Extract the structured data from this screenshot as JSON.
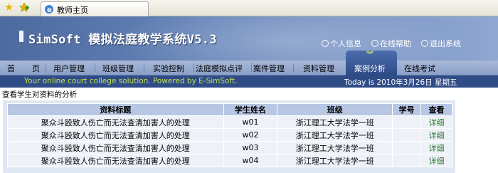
{
  "browser": {
    "tab_title": "教师主页"
  },
  "header": {
    "system_title": "SimSoft 模拟法庭教学系统V5.3",
    "links": [
      "个人信息",
      "在线帮助",
      "退出系统"
    ]
  },
  "nav": {
    "items": [
      "首",
      "页",
      "用户管理",
      "班级管理",
      "实验控制",
      "法庭模拟点评",
      "案件管理",
      "资料管理",
      "案例分析",
      "在线考试"
    ],
    "active": "案例分析"
  },
  "slogan": {
    "text": "Your online court college solution. Powered by E-SimSoft.",
    "today": "Today is  2010年3月26日  星期五"
  },
  "page_title": "查看学生对资料的分析",
  "table": {
    "columns": [
      "资料标题",
      "学生姓名",
      "班级",
      "学号",
      "查看"
    ],
    "rows": [
      [
        "聚众斗殴致人伤亡而无法查清加害人的处理",
        "w01",
        "浙江理工大学法学一班",
        "",
        "详细"
      ],
      [
        "聚众斗殴致人伤亡而无法查清加害人的处理",
        "w02",
        "浙江理工大学法学一班",
        "",
        "详细"
      ],
      [
        "聚众斗殴致人伤亡而无法查清加害人的处理",
        "w03",
        "浙江理工大学法学一班",
        "",
        "详细"
      ],
      [
        "聚众斗殴致人伤亡而无法查清加害人的处理",
        "w04",
        "浙江理工大学法学一班",
        "",
        "详细"
      ]
    ]
  },
  "colors": {
    "banner": "#5b78ad",
    "nav_active": "#3a5a99",
    "slogan_text": "#c4e24c",
    "detail_link": "#2a7a2a"
  }
}
